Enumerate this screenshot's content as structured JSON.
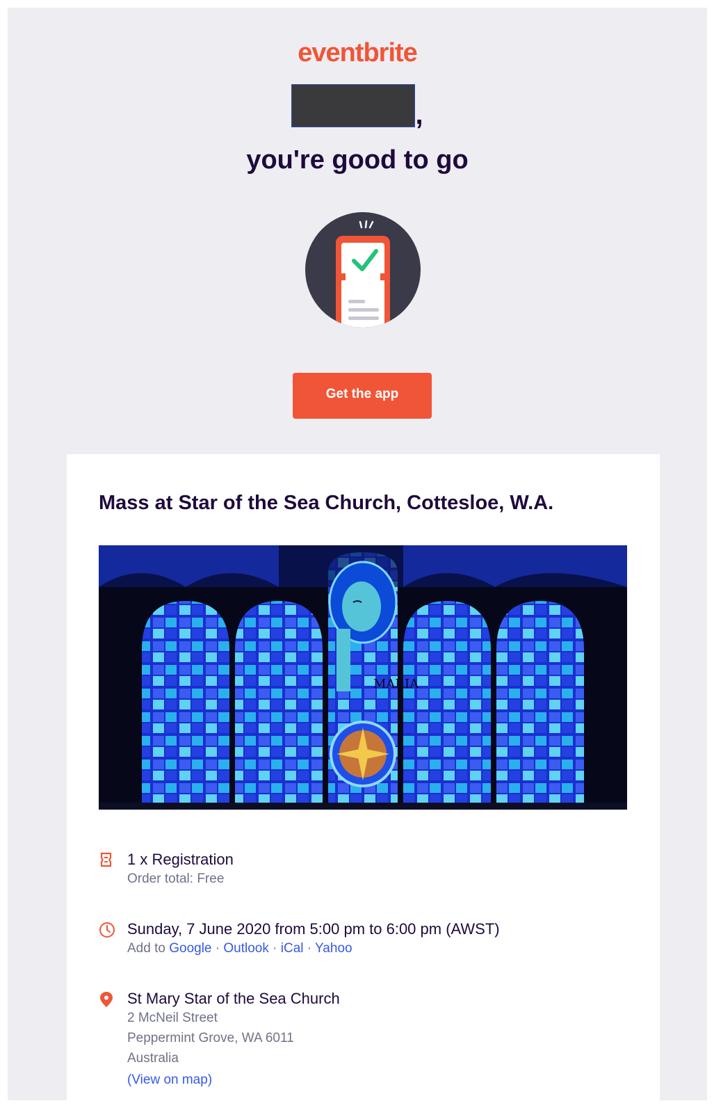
{
  "header": {
    "logo_text": "eventbrite",
    "comma": ",",
    "headline": "you're good to go",
    "cta_label": "Get the app"
  },
  "event": {
    "title": "Mass at Star of the Sea Church, Cottesloe, W.A.",
    "image_caption_letters": "MARIA"
  },
  "order": {
    "summary": "1 x Registration",
    "total": "Order total: Free"
  },
  "datetime": {
    "text": "Sunday, 7 June 2020 from 5:00 pm to 6:00 pm (AWST)",
    "add_to_label": "Add to",
    "calendars": [
      "Google",
      "Outlook",
      "iCal",
      "Yahoo"
    ],
    "separator": "·"
  },
  "location": {
    "venue": "St Mary Star of the Sea Church",
    "street": "2 McNeil Street",
    "city_line": "Peppermint Grove, WA 6011",
    "country": "Australia",
    "map_link": "(View on map)"
  },
  "colors": {
    "brand": "#f05537",
    "heading": "#1e0a3c",
    "link": "#3659e3",
    "muted": "#6f7287",
    "background": "#eeedf2"
  },
  "icons": [
    "ticket-icon",
    "clock-icon",
    "map-pin-icon",
    "phone-check-icon"
  ]
}
